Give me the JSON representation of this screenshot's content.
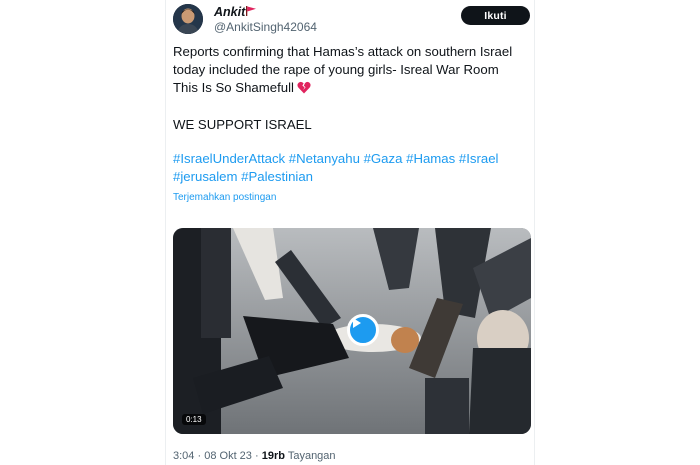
{
  "tweet": {
    "author_name": "Ankit",
    "author_handle": "@AnkitSingh42064",
    "follow_label": "Ikuti",
    "text_lines": [
      "Reports confirming that Hamas’s attack on southern Israel",
      "today included the rape of young girls- Isreal War Room",
      "This Is So Shamefull"
    ],
    "text_line_4": "WE SUPPORT ISRAEL",
    "hashtags_line1": "#IsraelUnderAttack #Netanyahu #Gaza #Hamas #Israel",
    "hashtags_line2": "#jerusalem #Palestinian",
    "translate_label": "Terjemahkan postingan",
    "media": {
      "duration": "0:13"
    },
    "meta": {
      "time": "3:04",
      "date": "08 Okt 23",
      "separator": "·",
      "views_count": "19rb",
      "views_label": "Tayangan"
    }
  },
  "colors": {
    "link": "#1d9bf0",
    "text": "#0f1419",
    "muted": "#536471",
    "follow_bg": "#0f1419"
  },
  "icons": [
    "red-flag-icon",
    "broken-heart-icon",
    "play-icon"
  ]
}
